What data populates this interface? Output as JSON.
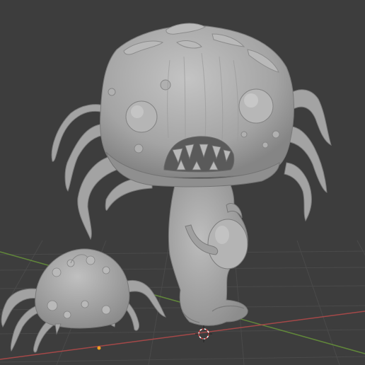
{
  "viewport": {
    "background_color": "#3d3d3d",
    "grid_line_color": "#4a4a4a",
    "x_axis_color": "#b04a4a",
    "y_axis_color": "#6a9a3a",
    "origin_dot_color": "#f0a020",
    "cursor_color": "#d04040",
    "mesh_color": "#a9a9a9",
    "mesh_shadow_color": "#6e6e6e",
    "mesh_highlight_color": "#c9c9c9"
  },
  "scene": {
    "objects": [
      {
        "name": "mushroom-creature-figure"
      },
      {
        "name": "small-spider-creature"
      }
    ],
    "icons": [
      "3d-cursor-icon",
      "origin-point-icon"
    ]
  }
}
